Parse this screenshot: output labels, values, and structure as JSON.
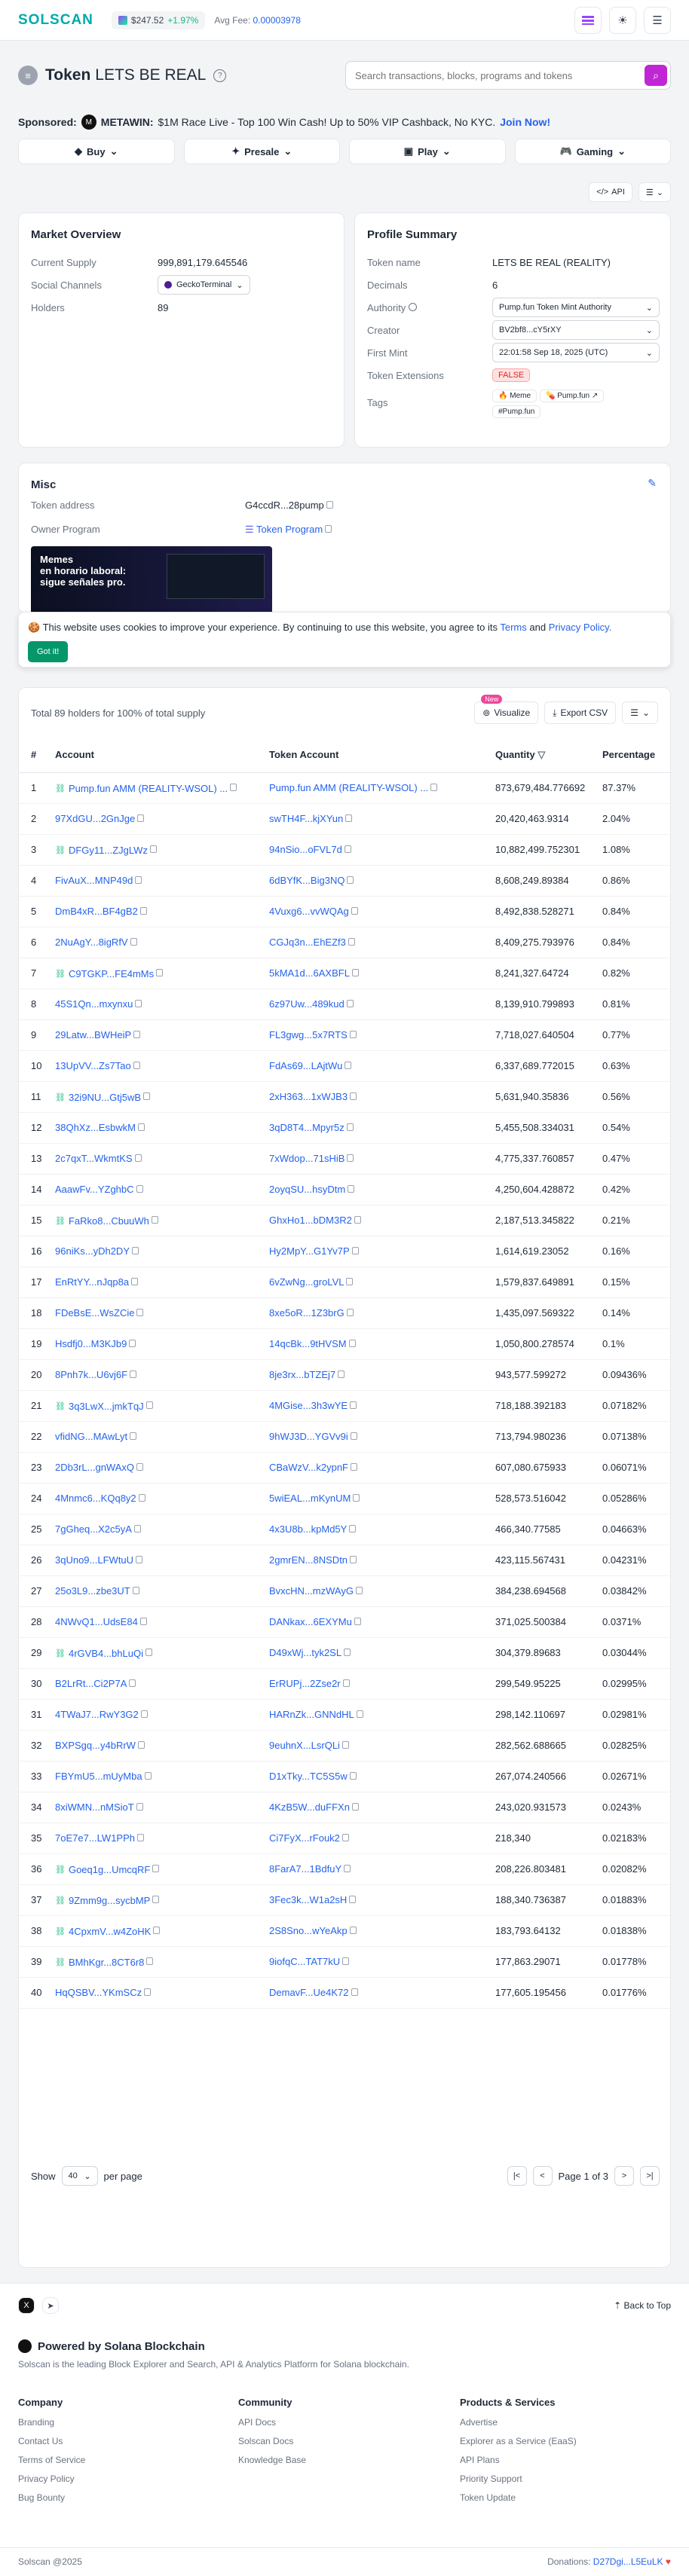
{
  "header": {
    "logo": "SOLSCAN",
    "sol_price": "$247.52",
    "sol_change": "+1.97%",
    "avg_fee_label": "Avg Fee:",
    "avg_fee": "0.00003978"
  },
  "token": {
    "label": "Token",
    "name": "LETS BE REAL"
  },
  "search": {
    "placeholder": "Search transactions, blocks, programs and tokens"
  },
  "sponsor": {
    "label": "Sponsored:",
    "brand": "METAWIN:",
    "text": "$1M Race Live - Top 100 Win Cash! Up to 50% VIP Cashback, No KYC.",
    "cta": "Join Now!"
  },
  "nav": {
    "buy": "Buy",
    "presale": "Presale",
    "play": "Play",
    "gaming": "Gaming"
  },
  "api": "API",
  "market": {
    "title": "Market Overview",
    "supply_label": "Current Supply",
    "supply": "999,891,179.645546",
    "social_label": "Social Channels",
    "social": "GeckoTerminal",
    "holders_label": "Holders",
    "holders": "89"
  },
  "profile": {
    "title": "Profile Summary",
    "name_label": "Token name",
    "name": "LETS BE REAL (REALITY)",
    "decimals_label": "Decimals",
    "decimals": "6",
    "authority_label": "Authority",
    "authority": "Pump.fun Token Mint Authority",
    "creator_label": "Creator",
    "creator": "BV2bf8...cY5rXY",
    "firstmint_label": "First Mint",
    "firstmint": "22:01:58 Sep 18, 2025 (UTC)",
    "ext_label": "Token Extensions",
    "ext": "FALSE",
    "tags_label": "Tags",
    "tags": [
      "Meme",
      "Pump.fun",
      "#Pump.fun"
    ]
  },
  "misc": {
    "title": "Misc",
    "addr_label": "Token address",
    "addr": "G4ccdR...28pump",
    "owner_label": "Owner Program",
    "owner": "Token Program",
    "ad_line1": "Memes",
    "ad_line2": "en horario laboral:",
    "ad_line3": "sigue señales pro."
  },
  "cookie": {
    "text_prefix": "This website uses cookies to improve your experience. By continuing to use this website, you agree to its",
    "terms": "Terms",
    "and": "and",
    "privacy": "Privacy Policy.",
    "button": "Got it!"
  },
  "holders_table": {
    "summary": "Total 89 holders for 100% of total supply",
    "new_badge": "New",
    "visualize": "Visualize",
    "export": "Export CSV",
    "columns": [
      "#",
      "Account",
      "Token Account",
      "Quantity",
      "Percentage"
    ],
    "rows": [
      [
        "1",
        "Pump.fun AMM (REALITY-WSOL) ...",
        "Pump.fun AMM (REALITY-WSOL) ...",
        "873,679,484.776692",
        "87.37%"
      ],
      [
        "2",
        "97XdGU...2GnJge",
        "swTH4F...kjXYun",
        "20,420,463.9314",
        "2.04%"
      ],
      [
        "3",
        "DFGy11...ZJgLWz",
        "94nSio...oFVL7d",
        "10,882,499.752301",
        "1.08%"
      ],
      [
        "4",
        "FivAuX...MNP49d",
        "6dBYfK...Big3NQ",
        "8,608,249.89384",
        "0.86%"
      ],
      [
        "5",
        "DmB4xR...BF4gB2",
        "4Vuxg6...vvWQAg",
        "8,492,838.528271",
        "0.84%"
      ],
      [
        "6",
        "2NuAgY...8igRfV",
        "CGJq3n...EhEZf3",
        "8,409,275.793976",
        "0.84%"
      ],
      [
        "7",
        "C9TGKP...FE4mMs",
        "5kMA1d...6AXBFL",
        "8,241,327.64724",
        "0.82%"
      ],
      [
        "8",
        "45S1Qn...mxynxu",
        "6z97Uw...489kud",
        "8,139,910.799893",
        "0.81%"
      ],
      [
        "9",
        "29Latw...BWHeiP",
        "FL3gwg...5x7RTS",
        "7,718,027.640504",
        "0.77%"
      ],
      [
        "10",
        "13UpVV...Zs7Tao",
        "FdAs69...LAjtWu",
        "6,337,689.772015",
        "0.63%"
      ],
      [
        "11",
        "32i9NU...Gtj5wB",
        "2xH363...1xWJB3",
        "5,631,940.35836",
        "0.56%"
      ],
      [
        "12",
        "38QhXz...EsbwkM",
        "3qD8T4...Mpyr5z",
        "5,455,508.334031",
        "0.54%"
      ],
      [
        "13",
        "2c7qxT...WkmtKS",
        "7xWdop...71sHiB",
        "4,775,337.760857",
        "0.47%"
      ],
      [
        "14",
        "AaawFv...YZghbC",
        "2oyqSU...hsyDtm",
        "4,250,604.428872",
        "0.42%"
      ],
      [
        "15",
        "FaRko8...CbuuWh",
        "GhxHo1...bDM3R2",
        "2,187,513.345822",
        "0.21%"
      ],
      [
        "16",
        "96niKs...yDh2DY",
        "Hy2MpY...G1Yv7P",
        "1,614,619.23052",
        "0.16%"
      ],
      [
        "17",
        "EnRtYY...nJqp8a",
        "6vZwNg...groLVL",
        "1,579,837.649891",
        "0.15%"
      ],
      [
        "18",
        "FDeBsE...WsZCie",
        "8xe5oR...1Z3brG",
        "1,435,097.569322",
        "0.14%"
      ],
      [
        "19",
        "Hsdfj0...M3KJb9",
        "14qcBk...9tHVSM",
        "1,050,800.278574",
        "0.1%"
      ],
      [
        "20",
        "8Pnh7k...U6vj6F",
        "8je3rx...bTZEj7",
        "943,577.599272",
        "0.09436%"
      ],
      [
        "21",
        "3q3LwX...jmkTqJ",
        "4MGise...3h3wYE",
        "718,188.392183",
        "0.07182%"
      ],
      [
        "22",
        "vfidNG...MAwLyt",
        "9hWJ3D...YGVv9i",
        "713,794.980236",
        "0.07138%"
      ],
      [
        "23",
        "2Db3rL...gnWAxQ",
        "CBaWzV...k2ypnF",
        "607,080.675933",
        "0.06071%"
      ],
      [
        "24",
        "4Mnmc6...KQq8y2",
        "5wiEAL...mKynUM",
        "528,573.516042",
        "0.05286%"
      ],
      [
        "25",
        "7gGheq...X2c5yA",
        "4x3U8b...kpMd5Y",
        "466,340.77585",
        "0.04663%"
      ],
      [
        "26",
        "3qUno9...LFWtuU",
        "2gmrEN...8NSDtn",
        "423,115.567431",
        "0.04231%"
      ],
      [
        "27",
        "25o3L9...zbe3UT",
        "BvxcHN...mzWAyG",
        "384,238.694568",
        "0.03842%"
      ],
      [
        "28",
        "4NWvQ1...UdsE84",
        "DANkax...6EXYMu",
        "371,025.500384",
        "0.0371%"
      ],
      [
        "29",
        "4rGVB4...bhLuQi",
        "D49xWj...tyk2SL",
        "304,379.89683",
        "0.03044%"
      ],
      [
        "30",
        "B2LrRt...Ci2P7A",
        "ErRUPj...2Zse2r",
        "299,549.95225",
        "0.02995%"
      ],
      [
        "31",
        "4TWaJ7...RwY3G2",
        "HARnZk...GNNdHL",
        "298,142.110697",
        "0.02981%"
      ],
      [
        "32",
        "BXPSgq...y4bRrW",
        "9euhnX...LsrQLi",
        "282,562.688665",
        "0.02825%"
      ],
      [
        "33",
        "FBYmU5...mUyMba",
        "D1xTky...TC5S5w",
        "267,074.240566",
        "0.02671%"
      ],
      [
        "34",
        "8xiWMN...nMSioT",
        "4KzB5W...duFFXn",
        "243,020.931573",
        "0.0243%"
      ],
      [
        "35",
        "7oE7e7...LW1PPh",
        "Ci7FyX...rFouk2",
        "218,340",
        "0.02183%"
      ],
      [
        "36",
        "Goeq1g...UmcqRF",
        "8FarA7...1BdfuY",
        "208,226.803481",
        "0.02082%"
      ],
      [
        "37",
        "9Zmm9g...sycbMP",
        "3Fec3k...W1a2sH",
        "188,340.736387",
        "0.01883%"
      ],
      [
        "38",
        "4CpxmV...w4ZoHK",
        "2S8Sno...wYeAkp",
        "183,793.64132",
        "0.01838%"
      ],
      [
        "39",
        "BMhKgr...8CT6r8",
        "9iofqC...TAT7kU",
        "177,863.29071",
        "0.01778%"
      ],
      [
        "40",
        "HqQSBV...YKmSCz",
        "DemavF...Ue4K72",
        "177,605.195456",
        "0.01776%"
      ]
    ],
    "contract_rows": [
      1,
      3,
      7,
      11,
      15,
      21,
      29,
      36,
      37,
      38,
      39
    ],
    "show_label": "Show",
    "page_size": "40",
    "per_page": "per page",
    "page_text": "Page 1 of 3"
  },
  "footer": {
    "back_to_top": "Back to Top",
    "powered": "Powered by Solana Blockchain",
    "desc": "Solscan is the leading Block Explorer and Search, API & Analytics Platform for Solana blockchain.",
    "company": {
      "title": "Company",
      "items": [
        "Branding",
        "Contact Us",
        "Terms of Service",
        "Privacy Policy",
        "Bug Bounty"
      ]
    },
    "community": {
      "title": "Community",
      "items": [
        "API Docs",
        "Solscan Docs",
        "Knowledge Base"
      ]
    },
    "products": {
      "title": "Products & Services",
      "items": [
        "Advertise",
        "Explorer as a Service (EaaS)",
        "API Plans",
        "Priority Support",
        "Token Update"
      ]
    },
    "copyright": "Solscan @2025",
    "donations_label": "Donations:",
    "donations": "D27Dgi...L5EuLK"
  },
  "colors": {
    "brand": "#0aa",
    "link": "#2563eb",
    "accent": "#c026d3",
    "up": "#10b981"
  }
}
